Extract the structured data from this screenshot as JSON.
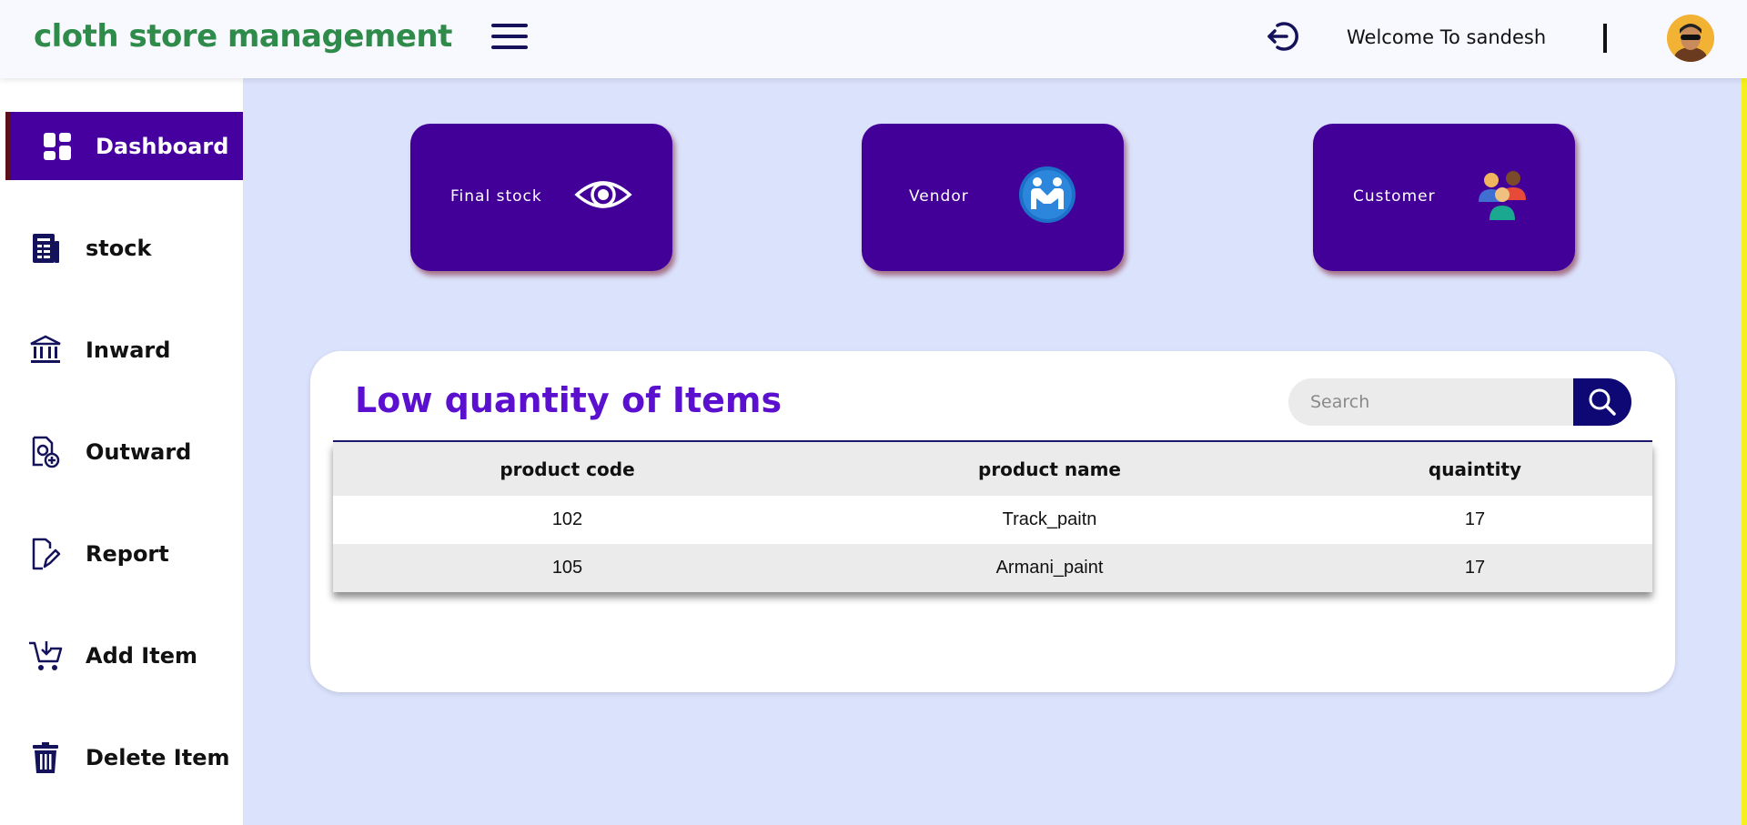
{
  "header": {
    "brand": "cloth store management",
    "welcome": "Welcome To sandesh",
    "icons": {
      "menu": "hamburger-menu-icon",
      "logout": "logout-icon",
      "avatar": "user-avatar"
    }
  },
  "sidebar": {
    "items": [
      {
        "label": "Dashboard",
        "icon": "dashboard-grid-icon",
        "active": true
      },
      {
        "label": "stock",
        "icon": "ledger-icon"
      },
      {
        "label": "Inward",
        "icon": "bank-icon"
      },
      {
        "label": "Outward",
        "icon": "document-gear-icon"
      },
      {
        "label": "Report",
        "icon": "report-edit-icon"
      },
      {
        "label": "Add Item",
        "icon": "cart-add-icon"
      },
      {
        "label": "Delete Item",
        "icon": "trash-icon"
      }
    ]
  },
  "cards": [
    {
      "label": "Final stock",
      "icon": "eye-icon"
    },
    {
      "label": "Vendor",
      "icon": "handshake-icon"
    },
    {
      "label": "Customer",
      "icon": "customers-group-icon"
    }
  ],
  "panel": {
    "title": "Low quantity of Items",
    "search_placeholder": "Search",
    "columns": [
      "product code",
      "product name",
      "quaintity"
    ],
    "rows": [
      {
        "code": "102",
        "name": "Track_paitn",
        "qty": "17"
      },
      {
        "code": "105",
        "name": "Armani_paint",
        "qty": "17"
      }
    ]
  },
  "colors": {
    "brand": "#2e8b4a",
    "accent": "#46009f",
    "background": "#dbe2fc",
    "title": "#5b10d0",
    "search_button": "#0e0875"
  }
}
